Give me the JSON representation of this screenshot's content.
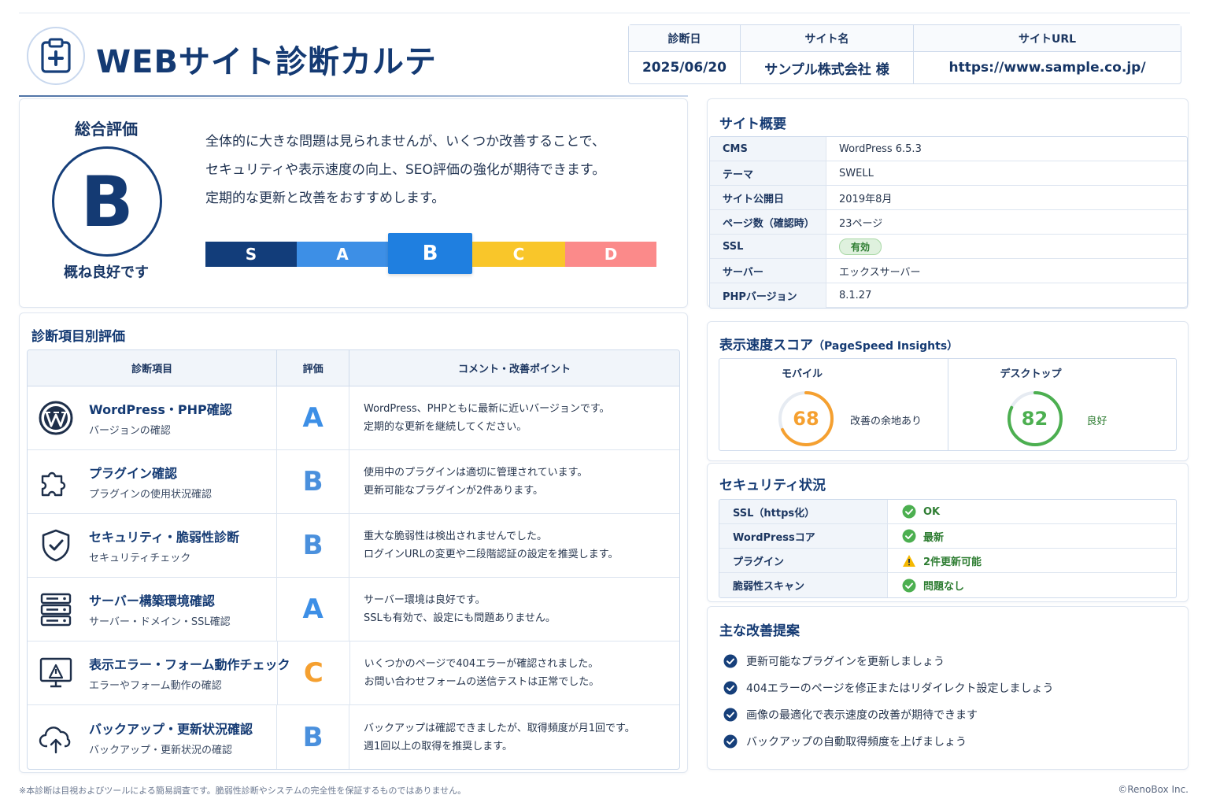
{
  "header": {
    "title": "WEBサイト診断カルテ",
    "info": [
      {
        "label": "診断日",
        "value": "2025/06/20"
      },
      {
        "label": "サイト名",
        "value": "サンプル株式会社 様"
      },
      {
        "label": "サイトURL",
        "value": "https://www.sample.co.jp/"
      }
    ]
  },
  "overall": {
    "label": "総合評価",
    "grade": "B",
    "sub": "概ね良好です",
    "summary": [
      "全体的に大きな問題は見られませんが、いくつか改善することで、",
      "セキュリティや表示速度の向上、SEO評価の強化が期待できます。",
      "定期的な更新と改善をおすすめします。"
    ],
    "scale": [
      {
        "label": "S",
        "color": "#123d7a"
      },
      {
        "label": "A",
        "color": "#3d8fe6"
      },
      {
        "label": "B",
        "color": "#1f7fe0"
      },
      {
        "label": "C",
        "color": "#f9c62a"
      },
      {
        "label": "D",
        "color": "#fb8a8a"
      }
    ],
    "active": "B"
  },
  "items": {
    "title": "診断項目別評価",
    "headers": [
      "診断項目",
      "評価",
      "コメント・改善ポイント"
    ],
    "rows": [
      {
        "icon": "wordpress-icon",
        "name": "WordPress・PHP確認",
        "sub": "バージョンの確認",
        "grade": "A",
        "grade_color": "#3d8fe6",
        "comment": [
          "WordPress、PHPともに最新に近いバージョンです。",
          "定期的な更新を継続してください。"
        ]
      },
      {
        "icon": "puzzle-icon",
        "name": "プラグイン確認",
        "sub": "プラグインの使用状況確認",
        "grade": "B",
        "grade_color": "#4a90dd",
        "comment": [
          "使用中のプラグインは適切に管理されています。",
          "更新可能なプラグインが2件あります。"
        ]
      },
      {
        "icon": "shield-check-icon",
        "name": "セキュリティ・脆弱性診断",
        "sub": "セキュリティチェック",
        "grade": "B",
        "grade_color": "#4a90dd",
        "comment": [
          "重大な脆弱性は検出されませんでした。",
          "ログインURLの変更や二段階認証の設定を推奨します。"
        ]
      },
      {
        "icon": "server-icon",
        "name": "サーバー構築環境確認",
        "sub": "サーバー・ドメイン・SSL確認",
        "grade": "A",
        "grade_color": "#3d8fe6",
        "comment": [
          "サーバー環境は良好です。",
          "SSLも有効で、設定にも問題ありません。"
        ]
      },
      {
        "icon": "monitor-warning-icon",
        "name": "表示エラー・フォーム動作チェック",
        "sub": "エラーやフォーム動作の確認",
        "grade": "C",
        "grade_color": "#f5a030",
        "comment": [
          "いくつかのページで404エラーが確認されました。",
          "お問い合わせフォームの送信テストは正常でした。"
        ]
      },
      {
        "icon": "cloud-sync-icon",
        "name": "バックアップ・更新状況確認",
        "sub": "バックアップ・更新状況の確認",
        "grade": "B",
        "grade_color": "#4a90dd",
        "comment": [
          "バックアップは確認できましたが、取得頻度が月1回です。",
          "週1回以上の取得を推奨します。"
        ]
      }
    ]
  },
  "overview": {
    "title": "サイト概要",
    "rows": [
      {
        "key": "CMS",
        "value": "WordPress 6.5.3"
      },
      {
        "key": "テーマ",
        "value": "SWELL"
      },
      {
        "key": "サイト公開日",
        "value": "2019年8月"
      },
      {
        "key": "ページ数（確認時）",
        "value": "23ページ"
      },
      {
        "key": "SSL",
        "value": "有効",
        "badge": true
      },
      {
        "key": "サーバー",
        "value": "エックスサーバー"
      },
      {
        "key": "PHPバージョン",
        "value": "8.1.27"
      }
    ]
  },
  "speed": {
    "title": "表示速度スコア",
    "title_suffix": "（PageSpeed Insights）",
    "cols": [
      {
        "label": "モバイル",
        "score": 68,
        "note": "改善の余地あり",
        "color": "#f5a030",
        "note_color": "#26354d"
      },
      {
        "label": "デスクトップ",
        "score": 82,
        "note": "良好",
        "color": "#4caf50",
        "note_color": "#2e7d32"
      }
    ]
  },
  "security": {
    "title": "セキュリティ状況",
    "rows": [
      {
        "key": "SSL（https化）",
        "value": "OK",
        "status": "ok",
        "color": "#2e7d32"
      },
      {
        "key": "WordPressコア",
        "value": "最新",
        "status": "ok",
        "color": "#2e7d32"
      },
      {
        "key": "プラグイン",
        "value": "2件更新可能",
        "status": "warn",
        "color": "#2e7d32"
      },
      {
        "key": "脆弱性スキャン",
        "value": "問題なし",
        "status": "ok",
        "color": "#2e7d32"
      }
    ]
  },
  "suggestions": {
    "title": "主な改善提案",
    "items": [
      "更新可能なプラグインを更新しましょう",
      "404エラーのページを修正またはリダイレクト設定しましょう",
      "画像の最適化で表示速度の改善が期待できます",
      "バックアップの自動取得頻度を上げましょう"
    ]
  },
  "footer": {
    "note": "※本診断は目視およびツールによる簡易調査です。脆弱性診断やシステムの完全性を保証するものではありません。",
    "copyright": "©RenoBox Inc."
  }
}
